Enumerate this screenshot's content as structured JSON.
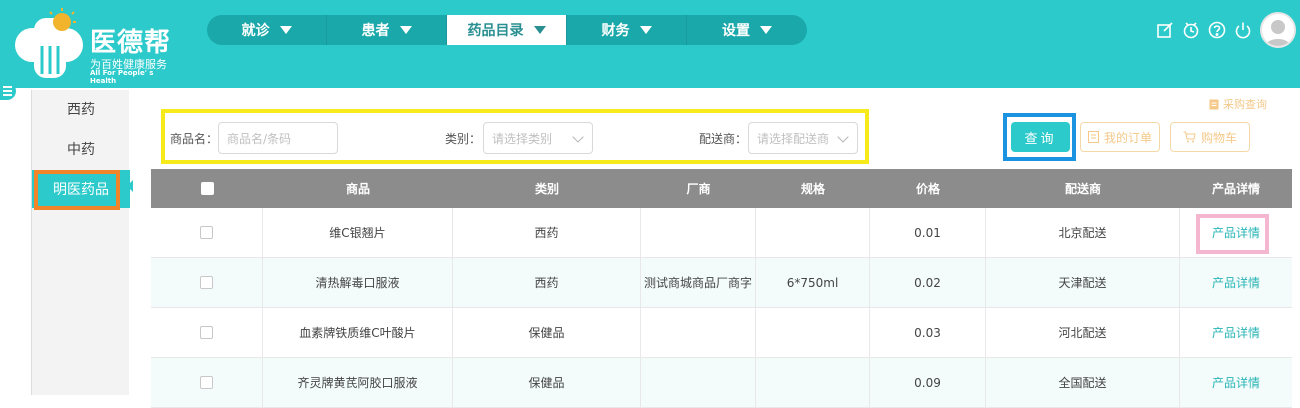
{
  "header": {
    "app_name": "医德帮",
    "slogan": "为百姓健康服务",
    "slogan_en": "All For People' s Health",
    "nav": [
      {
        "label": "就诊"
      },
      {
        "label": "患者"
      },
      {
        "label": "药品目录"
      },
      {
        "label": "财务"
      },
      {
        "label": "设置"
      }
    ],
    "active_nav": "药品目录",
    "icons": [
      "edit-icon",
      "notification-icon",
      "help-icon",
      "power-icon",
      "user-avatar"
    ]
  },
  "sidebar": {
    "items": [
      {
        "label": "西药"
      },
      {
        "label": "中药"
      },
      {
        "label": "明医药品"
      }
    ],
    "active": "明医药品"
  },
  "filters": {
    "name_label": "商品名：",
    "name_placeholder": "商品名/条码",
    "category_label": "类别：",
    "category_placeholder": "请选择类别",
    "supplier_label": "配送商：",
    "supplier_placeholder": "请选择配送商"
  },
  "actions": {
    "purchase_query": "采购查询",
    "query": "查询",
    "my_orders": "我的订单",
    "cart": "购物车"
  },
  "table": {
    "columns": [
      "商品",
      "类别",
      "厂商",
      "规格",
      "价格",
      "配送商",
      "产品详情"
    ],
    "rows": [
      {
        "name": "维C银翘片",
        "category": "西药",
        "maker": "",
        "spec": "",
        "price": "0.01",
        "supplier": "北京配送",
        "detail": "产品详情"
      },
      {
        "name": "清热解毒口服液",
        "category": "西药",
        "maker": "测试商城商品厂商字",
        "spec": "6*750ml",
        "price": "0.02",
        "supplier": "天津配送",
        "detail": "产品详情"
      },
      {
        "name": "血素牌铁质维C叶酸片",
        "category": "保健品",
        "maker": "",
        "spec": "",
        "price": "0.03",
        "supplier": "河北配送",
        "detail": "产品详情"
      },
      {
        "name": "齐灵牌黄芪阿胶口服液",
        "category": "保健品",
        "maker": "",
        "spec": "",
        "price": "0.09",
        "supplier": "全国配送",
        "detail": "产品详情"
      }
    ]
  },
  "colors": {
    "brand": "#2ccacb",
    "nav_bg": "#1aa8aa",
    "table_head": "#8c8c8c",
    "highlight_yellow": "#f7ea1a",
    "highlight_blue": "#1b93e0",
    "highlight_orange": "#f28429",
    "highlight_pink": "#f4b7cf",
    "accent_light_orange": "#f4c98a"
  }
}
